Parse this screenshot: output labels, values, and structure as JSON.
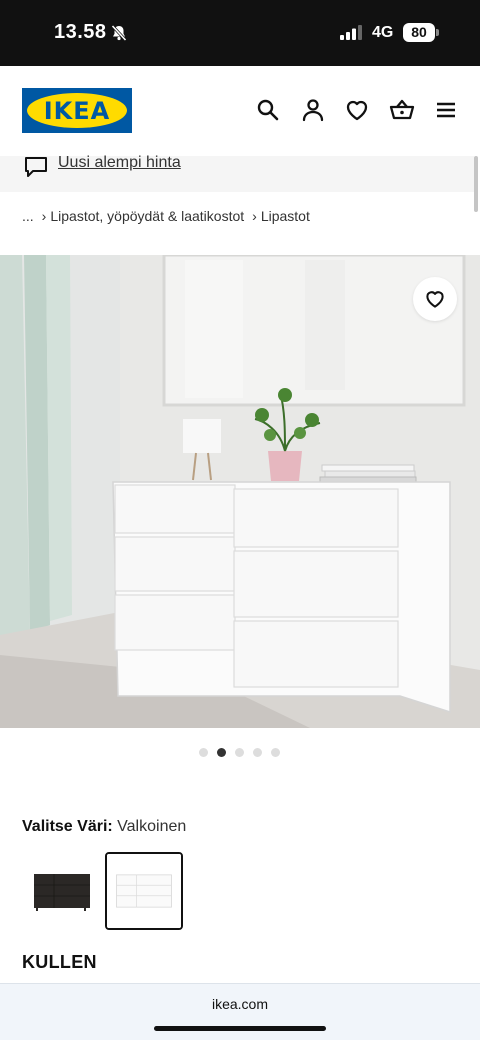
{
  "status_bar": {
    "time": "13.58",
    "network": "4G",
    "battery": "80"
  },
  "header": {
    "logo_text": "IKEA",
    "icons": [
      "search-icon",
      "account-icon",
      "heart-icon",
      "basket-icon",
      "menu-icon"
    ]
  },
  "promo": {
    "text": "Uusi alempi hinta"
  },
  "breadcrumb": {
    "items": [
      "...",
      "Lipastot, yöpöydät & laatikostot",
      "Lipastot"
    ]
  },
  "carousel": {
    "total": 5,
    "active_index": 1
  },
  "color_picker": {
    "label": "Valitse Väri:",
    "selected": "Valkoinen",
    "options": [
      {
        "name": "musta",
        "color": "#2b2826"
      },
      {
        "name": "Valkoinen",
        "color": "#ffffff",
        "selected": true
      }
    ]
  },
  "product": {
    "name": "KULLEN"
  },
  "browser": {
    "url": "ikea.com"
  },
  "colors": {
    "ikea_blue": "#0058a3",
    "ikea_yellow": "#ffdb00"
  }
}
